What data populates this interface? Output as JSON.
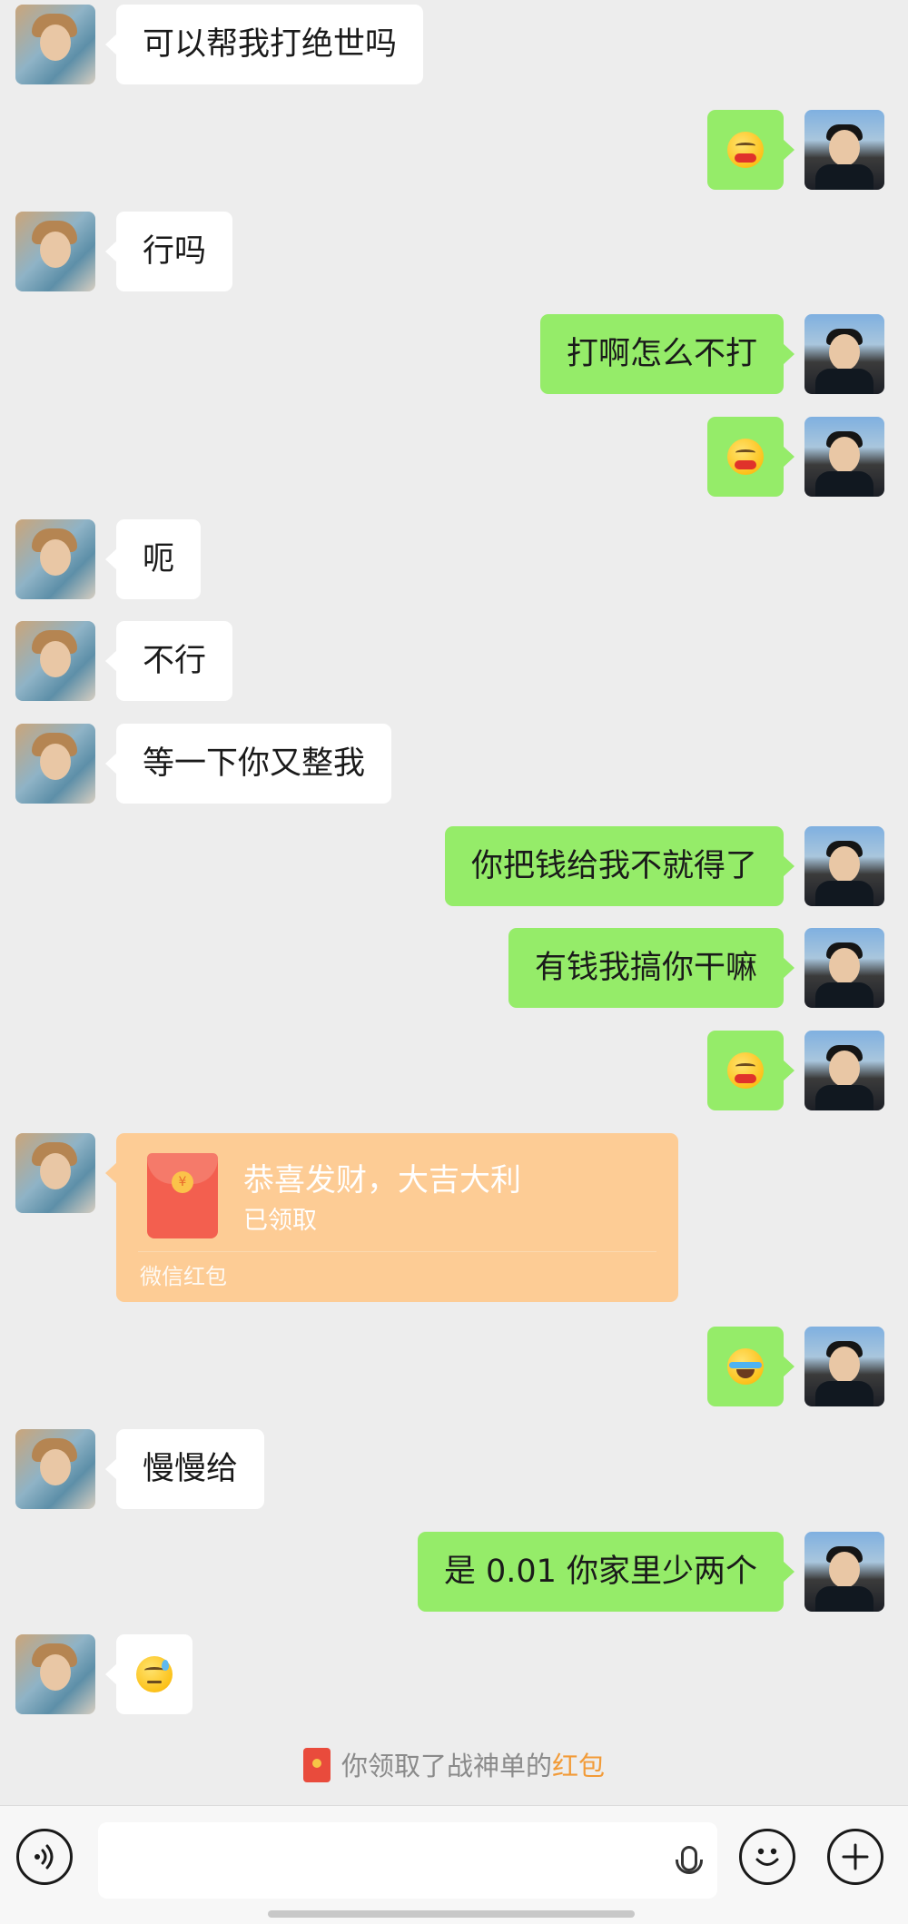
{
  "messages": [
    {
      "side": "peer",
      "type": "text",
      "text": "可以帮我打绝世吗"
    },
    {
      "side": "me",
      "type": "emoji",
      "emoji": "blush-face"
    },
    {
      "side": "peer",
      "type": "text",
      "text": "行吗"
    },
    {
      "side": "me",
      "type": "text",
      "text": "打啊怎么不打"
    },
    {
      "side": "me",
      "type": "emoji",
      "emoji": "blush-face"
    },
    {
      "side": "peer",
      "type": "text",
      "text": "呃"
    },
    {
      "side": "peer",
      "type": "text",
      "text": "不行"
    },
    {
      "side": "peer",
      "type": "text",
      "text": "等一下你又整我"
    },
    {
      "side": "me",
      "type": "text",
      "text": "你把钱给我不就得了"
    },
    {
      "side": "me",
      "type": "text",
      "text": "有钱我搞你干嘛"
    },
    {
      "side": "me",
      "type": "emoji",
      "emoji": "blush-face"
    },
    {
      "side": "peer",
      "type": "red_packet",
      "title": "恭喜发财，大吉大利",
      "status": "已领取",
      "brand": "微信红包"
    },
    {
      "side": "me",
      "type": "emoji",
      "emoji": "tears-of-joy-face"
    },
    {
      "side": "peer",
      "type": "text",
      "text": "慢慢给"
    },
    {
      "side": "me",
      "type": "text",
      "text": "是 0.01 你家里少两个"
    },
    {
      "side": "peer",
      "type": "emoji",
      "emoji": "sweat-face"
    }
  ],
  "system_notice": {
    "prefix": "你领取了战神单的",
    "highlight": "红包"
  },
  "input_bar": {
    "voice_icon": "voice-icon",
    "mic_icon": "microphone-icon",
    "emoji_icon": "smiley-icon",
    "plus_icon": "plus-icon"
  },
  "colors": {
    "background": "#ededed",
    "my_bubble": "#95ec69",
    "peer_bubble": "#ffffff",
    "red_packet": "#fdcc95",
    "highlight": "#f29b38"
  }
}
